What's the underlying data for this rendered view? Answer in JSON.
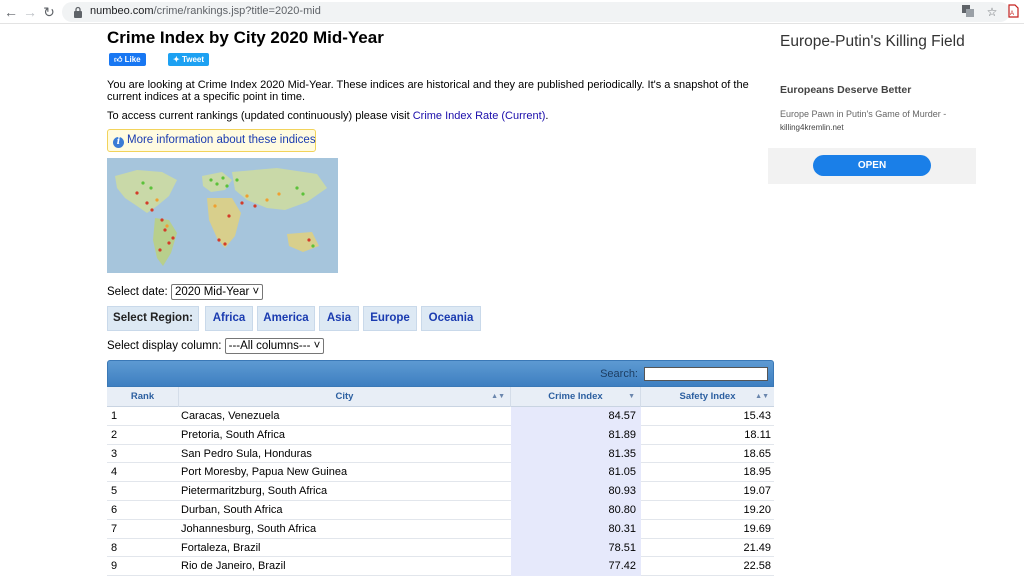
{
  "browser": {
    "url_host": "numbeo.com",
    "url_path": "/crime/rankings.jsp?title=2020-mid"
  },
  "page": {
    "title": "Crime Index by City 2020 Mid-Year",
    "like_label": "Like",
    "tweet_label": "Tweet",
    "intro": "You are looking at Crime Index 2020 Mid-Year. These indices are historical and they are published periodically. It's a snapshot of the current indices at a specific point in time.",
    "access_text": "To access current rankings (updated continuously) please visit ",
    "access_link": "Crime Index Rate (Current)",
    "access_end": ".",
    "more_info": "More information about these indices",
    "select_date_label": "Select date:",
    "select_date_value": "2020 Mid-Year",
    "select_region_label": "Select Region:",
    "regions": [
      "Africa",
      "America",
      "Asia",
      "Europe",
      "Oceania"
    ],
    "select_column_label": "Select display column:",
    "select_column_value": "---All columns---"
  },
  "table": {
    "search_label": "Search:",
    "columns": [
      "Rank",
      "City",
      "Crime Index",
      "Safety Index"
    ],
    "rows": [
      {
        "rank": "1",
        "city": "Caracas, Venezuela",
        "crime": "84.57",
        "safety": "15.43"
      },
      {
        "rank": "2",
        "city": "Pretoria, South Africa",
        "crime": "81.89",
        "safety": "18.11"
      },
      {
        "rank": "3",
        "city": "San Pedro Sula, Honduras",
        "crime": "81.35",
        "safety": "18.65"
      },
      {
        "rank": "4",
        "city": "Port Moresby, Papua New Guinea",
        "crime": "81.05",
        "safety": "18.95"
      },
      {
        "rank": "5",
        "city": "Pietermaritzburg, South Africa",
        "crime": "80.93",
        "safety": "19.07"
      },
      {
        "rank": "6",
        "city": "Durban, South Africa",
        "crime": "80.80",
        "safety": "19.20"
      },
      {
        "rank": "7",
        "city": "Johannesburg, South Africa",
        "crime": "80.31",
        "safety": "19.69"
      },
      {
        "rank": "8",
        "city": "Fortaleza, Brazil",
        "crime": "78.51",
        "safety": "21.49"
      },
      {
        "rank": "9",
        "city": "Rio de Janeiro, Brazil",
        "crime": "77.42",
        "safety": "22.58"
      }
    ]
  },
  "ad": {
    "title": "Europe-Putin's Killing Field",
    "subtitle": "Europeans Deserve Better",
    "description": "Europe Pawn in Putin's Game of Murder -",
    "url": "killing4kremlin.net",
    "button": "OPEN"
  },
  "colors": {
    "link": "#1a0dab",
    "table_header": "#4a8bc9",
    "ad_button": "#1a7fe8"
  }
}
